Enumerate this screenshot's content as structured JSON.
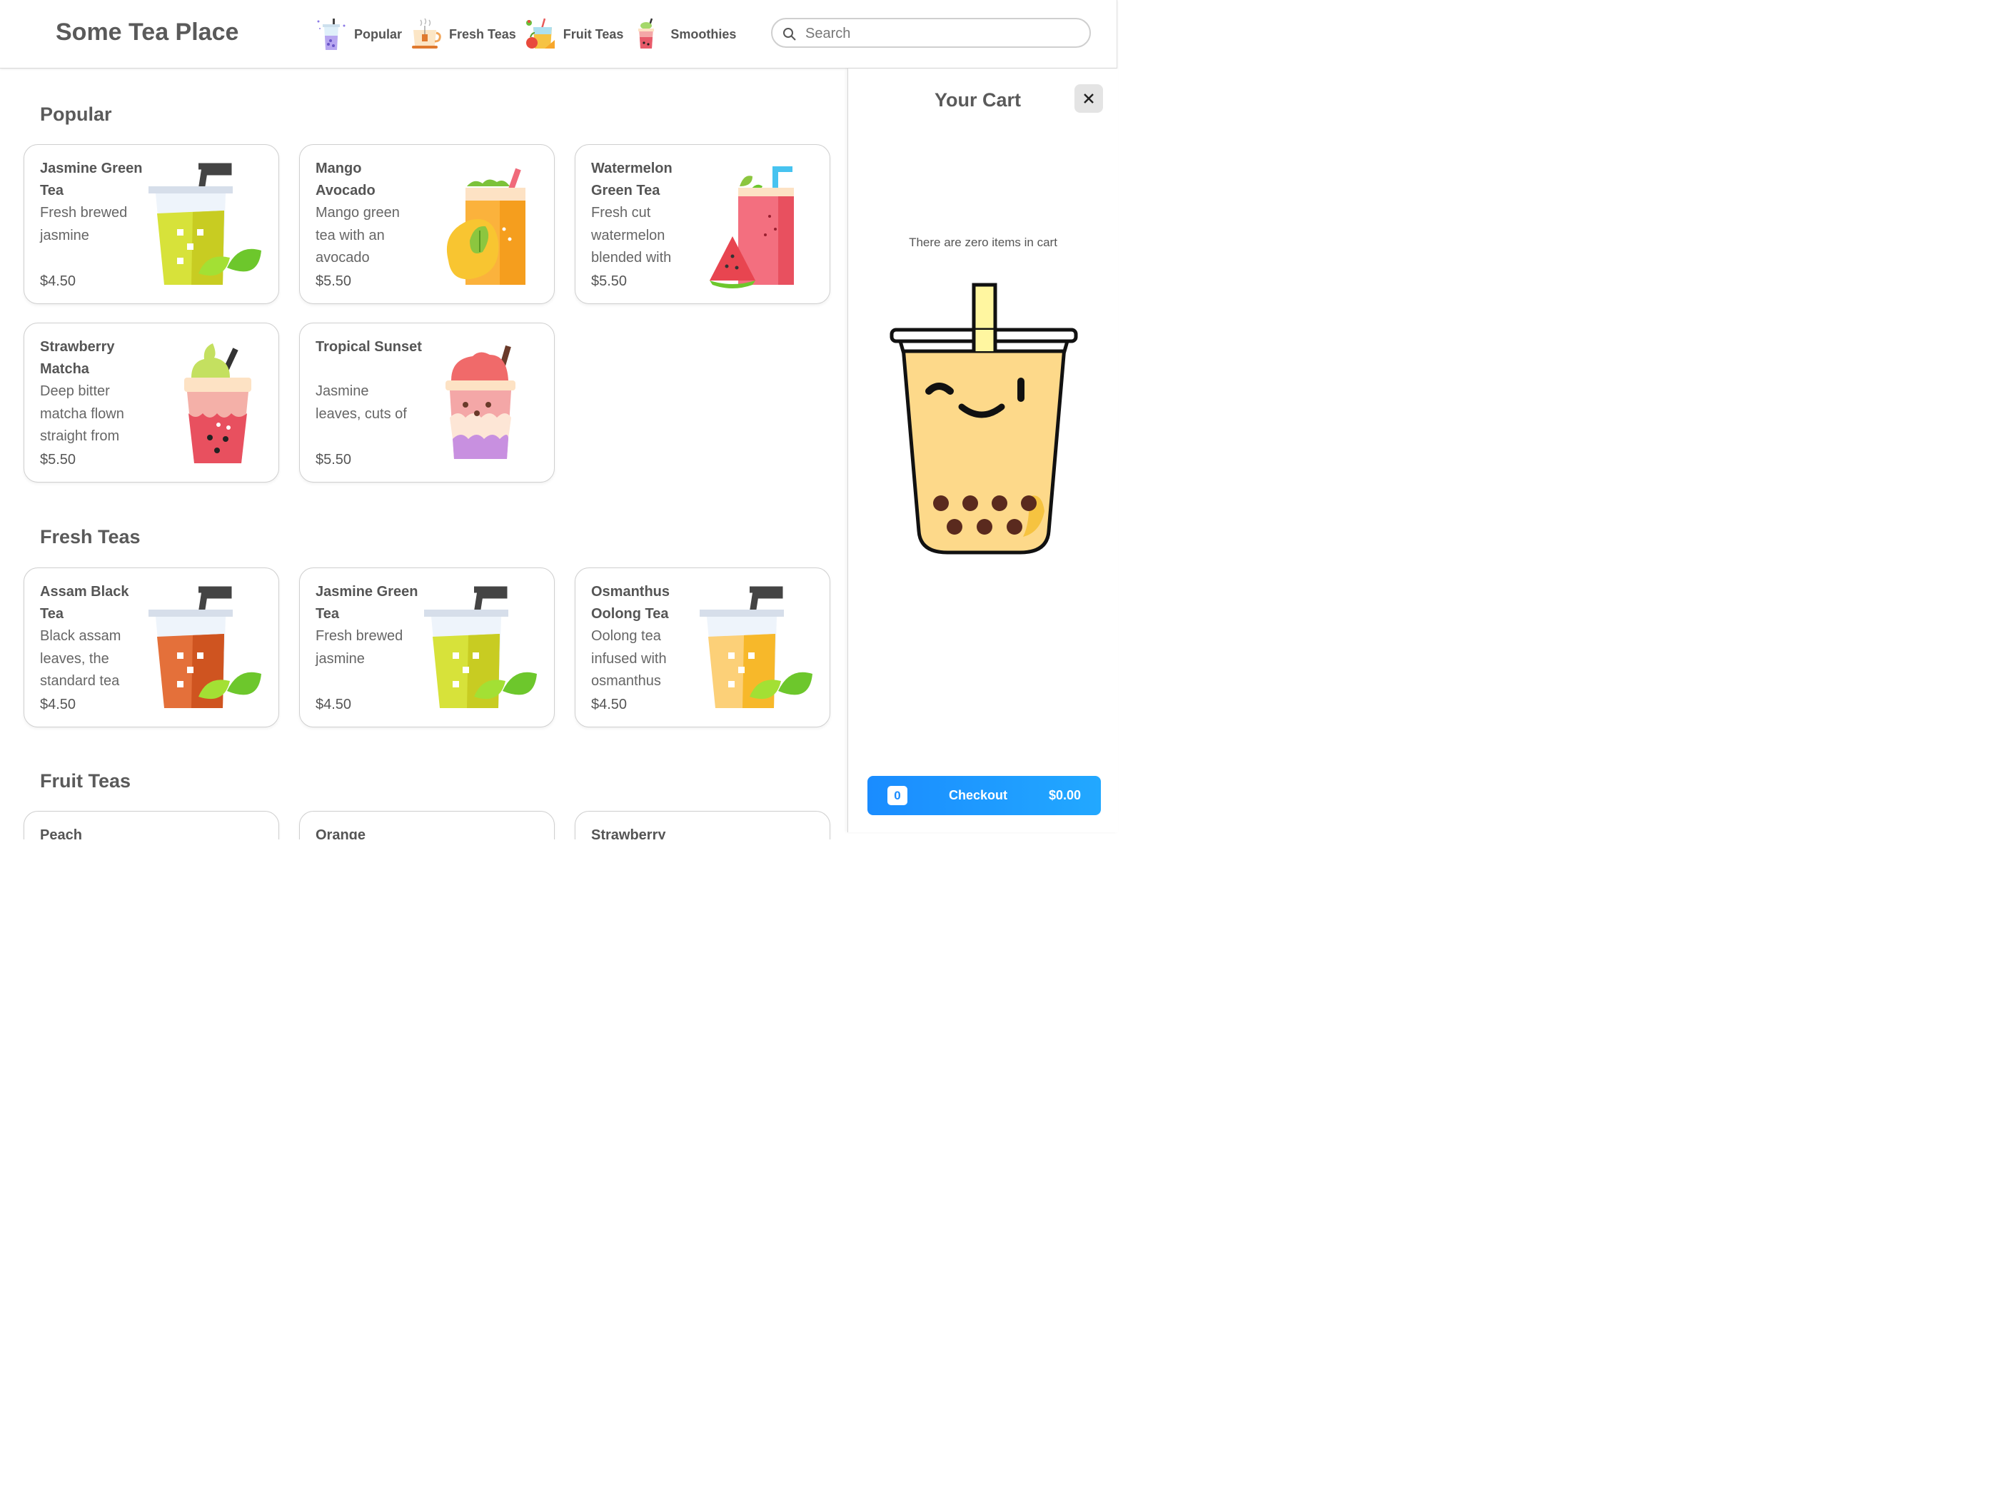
{
  "header": {
    "brand": "Some Tea Place",
    "nav": [
      {
        "label": "Popular",
        "icon": "popular-drink-icon"
      },
      {
        "label": "Fresh Teas",
        "icon": "tea-cup-icon"
      },
      {
        "label": "Fruit Teas",
        "icon": "fruit-drink-icon"
      },
      {
        "label": "Smoothies",
        "icon": "smoothie-icon"
      }
    ],
    "search_placeholder": "Search"
  },
  "sections": [
    {
      "title": "Popular",
      "items": [
        {
          "name": "Jasmine Green Tea",
          "desc": "Fresh brewed jasmine",
          "price": "$4.50",
          "icon": "jasmine-green-tea-icon"
        },
        {
          "name": "Mango Avocado",
          "desc": "Mango green tea with an avocado",
          "price": "$5.50",
          "icon": "mango-avocado-icon"
        },
        {
          "name": "Watermelon Green Tea",
          "desc": "Fresh cut watermelon blended with",
          "price": "$5.50",
          "icon": "watermelon-drink-icon"
        },
        {
          "name": "Strawberry Matcha",
          "desc": "Deep bitter matcha flown straight from",
          "price": "$5.50",
          "icon": "strawberry-matcha-icon"
        },
        {
          "name": "Tropical Sunset",
          "desc": "Jasmine leaves, cuts of",
          "price": "$5.50",
          "icon": "tropical-sunset-icon"
        }
      ]
    },
    {
      "title": "Fresh Teas",
      "items": [
        {
          "name": "Assam Black Tea",
          "desc": "Black assam leaves, the standard tea",
          "price": "$4.50",
          "icon": "black-tea-icon"
        },
        {
          "name": "Jasmine Green Tea",
          "desc": "Fresh brewed jasmine",
          "price": "$4.50",
          "icon": "jasmine-green-tea-icon"
        },
        {
          "name": "Osmanthus Oolong Tea",
          "desc": "Oolong tea infused with osmanthus",
          "price": "$4.50",
          "icon": "oolong-tea-icon"
        }
      ]
    },
    {
      "title": "Fruit Teas",
      "items": [
        {
          "name": "Peach",
          "icon": "peach-drink-icon"
        },
        {
          "name": "Orange",
          "icon": "orange-drink-icon"
        },
        {
          "name": "Strawberry",
          "icon": "strawberry-drink-icon"
        }
      ]
    }
  ],
  "cart": {
    "title": "Your Cart",
    "empty_text": "There are zero items in cart",
    "count": "0",
    "checkout_label": "Checkout",
    "total": "$0.00"
  },
  "colors": {
    "accent": "#1a8cff",
    "text": "#555555",
    "border": "#cfcfcf"
  }
}
